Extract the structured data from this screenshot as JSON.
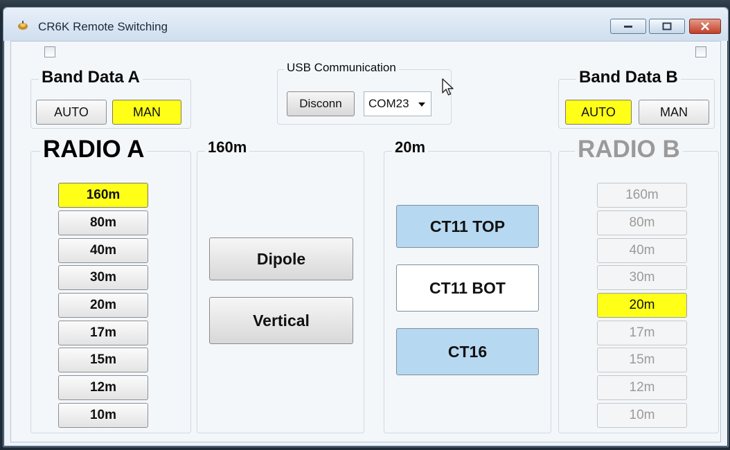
{
  "window": {
    "title": "CR6K Remote Switching"
  },
  "band_a": {
    "label": "Band Data A",
    "auto": "AUTO",
    "man": "MAN",
    "active": "MAN"
  },
  "band_b": {
    "label": "Band Data B",
    "auto": "AUTO",
    "man": "MAN",
    "active": "AUTO"
  },
  "usb": {
    "label": "USB Communication",
    "disconnect": "Disconn",
    "port": "COM23"
  },
  "radio_a": {
    "label": "RADIO A",
    "bands": [
      "160m",
      "80m",
      "40m",
      "30m",
      "20m",
      "17m",
      "15m",
      "12m",
      "10m"
    ],
    "selected": "160m"
  },
  "radio_b": {
    "label": "RADIO B",
    "bands": [
      "160m",
      "80m",
      "40m",
      "30m",
      "20m",
      "17m",
      "15m",
      "12m",
      "10m"
    ],
    "selected": "20m"
  },
  "antenna_a": {
    "band": "160m",
    "buttons": [
      "Dipole",
      "Vertical"
    ]
  },
  "antenna_b": {
    "band": "20m",
    "buttons": [
      {
        "label": "CT11 TOP",
        "state": "selected"
      },
      {
        "label": "CT11 BOT",
        "state": "unselected"
      },
      {
        "label": "CT16",
        "state": "selected"
      }
    ]
  },
  "colors": {
    "highlight": "#ffff17",
    "antenna_selected": "#b7d8f1"
  },
  "icons": [
    "app-icon",
    "minimize-icon",
    "maximize-icon",
    "close-icon",
    "dropdown-arrow-icon",
    "mouse-cursor-icon"
  ]
}
